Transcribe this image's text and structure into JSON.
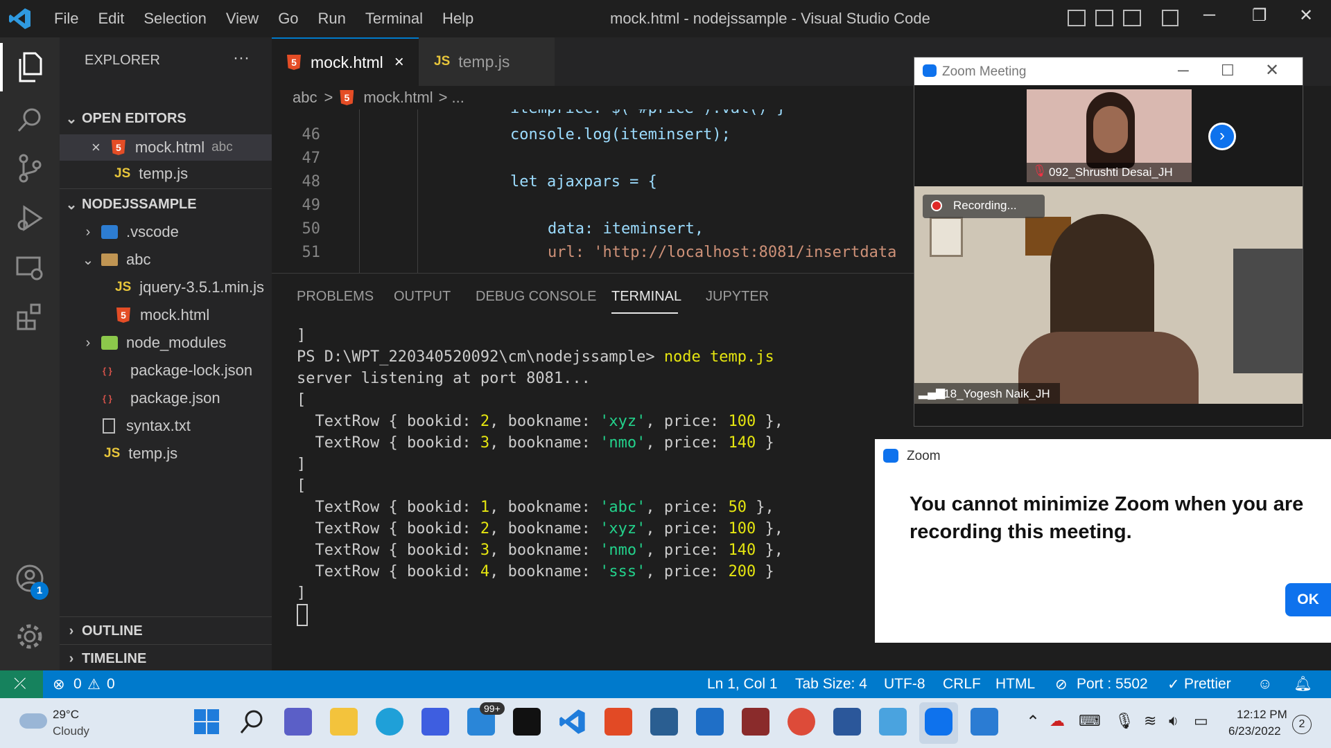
{
  "titlebar": {
    "menu": [
      "File",
      "Edit",
      "Selection",
      "View",
      "Go",
      "Run",
      "Terminal",
      "Help"
    ],
    "title": "mock.html - nodejssample - Visual Studio Code"
  },
  "activity": {
    "accounts_badge": "1"
  },
  "sidebar": {
    "explorer_label": "EXPLORER",
    "more": "···",
    "open_editors_label": "OPEN EDITORS",
    "open_editors": [
      {
        "name": "mock.html",
        "path": "abc",
        "type": "html",
        "close": "×"
      },
      {
        "name": "temp.js",
        "type": "js"
      }
    ],
    "project_label": "NODEJSSAMPLE",
    "tree": [
      {
        "name": ".vscode",
        "type": "vscode",
        "chev": "›"
      },
      {
        "name": "abc",
        "type": "folder",
        "chev": "⌄"
      },
      {
        "name": "jquery-3.5.1.min.js",
        "type": "js"
      },
      {
        "name": "mock.html",
        "type": "html"
      },
      {
        "name": "node_modules",
        "type": "nm",
        "chev": "›"
      },
      {
        "name": "package-lock.json",
        "type": "json"
      },
      {
        "name": "package.json",
        "type": "json"
      },
      {
        "name": "syntax.txt",
        "type": "txt"
      },
      {
        "name": "temp.js",
        "type": "js"
      }
    ],
    "outline_label": "OUTLINE",
    "timeline_label": "TIMELINE"
  },
  "tabs": [
    {
      "label": "mock.html",
      "type": "html",
      "close": "×"
    },
    {
      "label": "temp.js",
      "type": "js"
    }
  ],
  "breadcrumb": {
    "folder": "abc",
    "sep": ">",
    "file": "mock.html",
    "tail": "> ..."
  },
  "code": {
    "partial_line": "itemprice: $(\"#price\").val() }",
    "lines": [
      {
        "num": "46",
        "text": "console.log(iteminsert);"
      },
      {
        "num": "47",
        "text": ""
      },
      {
        "num": "48",
        "text": "let ajaxpars = {"
      },
      {
        "num": "49",
        "text": ""
      },
      {
        "num": "50",
        "text": "data: iteminsert,"
      },
      {
        "num": "51",
        "text": "url: 'http://localhost:8081/insertdata"
      }
    ]
  },
  "panel": {
    "tabs": [
      "PROBLEMS",
      "OUTPUT",
      "DEBUG CONSOLE",
      "TERMINAL",
      "JUPYTER"
    ],
    "active": "TERMINAL",
    "terminal": {
      "bracket_close": "]",
      "prompt": "PS D:\\WPT_220340520092\\cm\\nodejssample>",
      "command": "node temp.js",
      "listening": "server listening at port 8081...",
      "bracket_open": "[",
      "rows_first": [
        {
          "id": "2",
          "name": "'xyz'",
          "price": "100"
        },
        {
          "id": "3",
          "name": "'nmo'",
          "price": "140"
        }
      ],
      "rows_second": [
        {
          "id": "1",
          "name": "'abc'",
          "price": "50"
        },
        {
          "id": "2",
          "name": "'xyz'",
          "price": "100"
        },
        {
          "id": "3",
          "name": "'nmo'",
          "price": "140"
        },
        {
          "id": "4",
          "name": "'sss'",
          "price": "200"
        }
      ]
    }
  },
  "statusbar": {
    "errors": "0",
    "warnings": "0",
    "position": "Ln 1, Col 1",
    "tab_size": "Tab Size: 4",
    "encoding": "UTF-8",
    "eol": "CRLF",
    "language": "HTML",
    "port": "Port : 5502",
    "prettier": "Prettier"
  },
  "zoom_meeting": {
    "title": "Zoom Meeting",
    "participant_top": "092_Shrushti Desai_JH",
    "recording": "Recording...",
    "participant_main": "118_Yogesh Naik_JH"
  },
  "zoom_dialog": {
    "title": "Zoom",
    "message": "You cannot minimize Zoom when you are recording this meeting.",
    "ok": "OK"
  },
  "taskbar": {
    "weather_temp": "29°C",
    "weather_desc": "Cloudy",
    "mail_badge": "99+",
    "time": "12:12 PM",
    "date": "6/23/2022",
    "notifications": "2"
  },
  "colors": {
    "accent": "#007acc",
    "zoom_blue": "#0e72ed",
    "html_orange": "#e44d26",
    "js_yellow": "#e8c63b"
  }
}
